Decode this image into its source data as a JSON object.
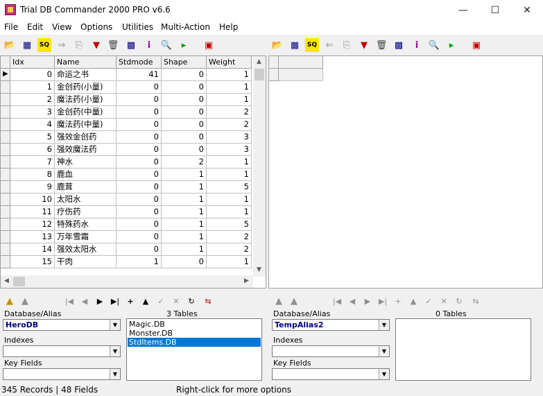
{
  "window": {
    "title": "Trial DB Commander 2000 PRO v6.6"
  },
  "menu": [
    "File",
    "Edit",
    "View",
    "Options",
    "Utilities",
    "Multi-Action",
    "Help"
  ],
  "grid": {
    "headers": [
      "Idx",
      "Name",
      "Stdmode",
      "Shape",
      "Weight"
    ],
    "rows": [
      [
        "0",
        "命运之书",
        "41",
        "0",
        "1"
      ],
      [
        "1",
        "金创药(小量)",
        "0",
        "0",
        "1"
      ],
      [
        "2",
        "魔法药(小量)",
        "0",
        "0",
        "1"
      ],
      [
        "3",
        "金创药(中量)",
        "0",
        "0",
        "2"
      ],
      [
        "4",
        "魔法药(中量)",
        "0",
        "0",
        "2"
      ],
      [
        "5",
        "强效金创药",
        "0",
        "0",
        "3"
      ],
      [
        "6",
        "强效魔法药",
        "0",
        "0",
        "3"
      ],
      [
        "7",
        "神水",
        "0",
        "2",
        "1"
      ],
      [
        "8",
        "鹿血",
        "0",
        "1",
        "1"
      ],
      [
        "9",
        "鹿茸",
        "0",
        "1",
        "5"
      ],
      [
        "10",
        "太阳水",
        "0",
        "1",
        "1"
      ],
      [
        "11",
        "疗伤药",
        "0",
        "1",
        "1"
      ],
      [
        "12",
        "特殊药水",
        "0",
        "1",
        "5"
      ],
      [
        "13",
        "万年雪霜",
        "0",
        "1",
        "2"
      ],
      [
        "14",
        "强效太阳水",
        "0",
        "1",
        "2"
      ],
      [
        "15",
        "干肉",
        "1",
        "0",
        "1"
      ]
    ]
  },
  "left_panel": {
    "database_label": "Database/Alias",
    "database_value": "HeroDB",
    "indexes_label": "Indexes",
    "keyfields_label": "Key Fields",
    "tables_count": "3 Tables",
    "tables": [
      "Magic.DB",
      "Monster.DB",
      "StdItems.DB"
    ],
    "selected_table": 2
  },
  "right_panel": {
    "database_label": "Database/Alias",
    "database_value": "TempAlias2",
    "indexes_label": "Indexes",
    "keyfields_label": "Key Fields",
    "tables_count": "0 Tables"
  },
  "status": {
    "records": "345 Records | 48 Fields",
    "hint": "Right-click for more options"
  },
  "icons": {
    "toolbar_left": [
      "folder-open-icon",
      "table-icon",
      "sql-icon",
      "arrow-right-icon",
      "export-icon",
      "filter-icon",
      "trash-icon",
      "grid-icon",
      "info-icon",
      "search-icon",
      "run-icon",
      "exit-icon"
    ],
    "toolbar_right": [
      "folder-open-icon",
      "table-icon",
      "sql-icon",
      "arrow-left-icon",
      "import-icon",
      "filter-icon",
      "trash-icon",
      "grid-icon",
      "info-icon",
      "search-icon",
      "run-icon",
      "exit-icon"
    ]
  }
}
